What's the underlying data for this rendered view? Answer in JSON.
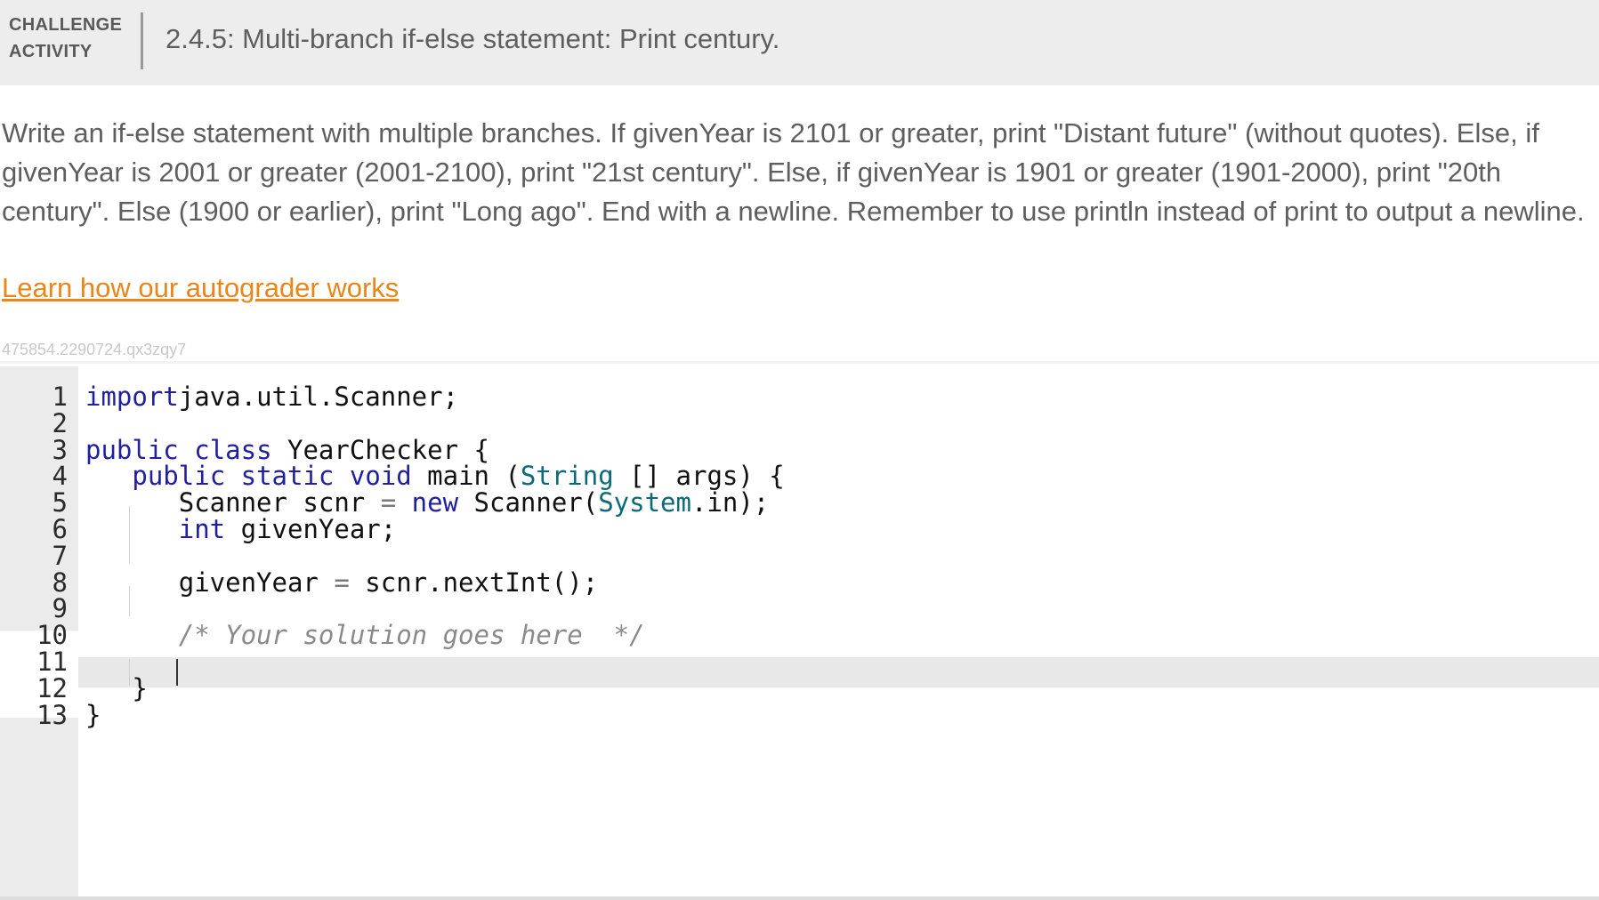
{
  "header": {
    "badge_line1": "CHALLENGE",
    "badge_line2": "ACTIVITY",
    "title": "2.4.5: Multi-branch if-else statement: Print century."
  },
  "description": "Write an if-else statement with multiple branches. If givenYear is 2101 or greater, print \"Distant future\" (without quotes). Else, if givenYear is 2001 or greater (2001-2100), print \"21st century\". Else, if givenYear is 1901 or greater (1901-2000), print \"20th century\". Else (1900 or earlier), print \"Long ago\". End with a newline. Remember to use println instead of print to output a newline.",
  "learn_link": "Learn how our autograder works",
  "activity_id": "475854.2290724.qx3zqy7",
  "editor": {
    "line_numbers": [
      "1",
      "2",
      "3",
      "4",
      "5",
      "6",
      "7",
      "8",
      "9",
      "10",
      "11",
      "12",
      "13"
    ],
    "active_line": 10,
    "lines": [
      {
        "tokens": [
          [
            "kw",
            "import"
          ],
          [
            "",
            "java.util.Scanner;"
          ]
        ]
      },
      {
        "tokens": []
      },
      {
        "tokens": [
          [
            "kw",
            "public"
          ],
          [
            "",
            " "
          ],
          [
            "kw",
            "class"
          ],
          [
            "",
            " YearChecker {"
          ]
        ]
      },
      {
        "tokens": [
          [
            "",
            "   "
          ],
          [
            "kw",
            "public"
          ],
          [
            "",
            " "
          ],
          [
            "kw",
            "static"
          ],
          [
            "",
            " "
          ],
          [
            "kw",
            "void"
          ],
          [
            "",
            " main ("
          ],
          [
            "ty",
            "String"
          ],
          [
            "",
            " [] args) {"
          ]
        ]
      },
      {
        "tokens": [
          [
            "",
            "      Scanner scnr "
          ],
          [
            "op",
            "="
          ],
          [
            "",
            " "
          ],
          [
            "kw",
            "new"
          ],
          [
            "",
            " Scanner("
          ],
          [
            "ty",
            "System"
          ],
          [
            "",
            ".in);"
          ]
        ]
      },
      {
        "tokens": [
          [
            "",
            "      "
          ],
          [
            "kw",
            "int"
          ],
          [
            "",
            " givenYear;"
          ]
        ]
      },
      {
        "tokens": []
      },
      {
        "tokens": [
          [
            "",
            "      givenYear "
          ],
          [
            "op",
            "="
          ],
          [
            "",
            " scnr.nextInt();"
          ]
        ]
      },
      {
        "tokens": []
      },
      {
        "tokens": [
          [
            "",
            "      "
          ],
          [
            "cm",
            "/* Your solution goes here  */"
          ]
        ]
      },
      {
        "tokens": []
      },
      {
        "tokens": [
          [
            "",
            "   }"
          ]
        ]
      },
      {
        "tokens": [
          [
            "",
            "}"
          ]
        ]
      }
    ]
  }
}
